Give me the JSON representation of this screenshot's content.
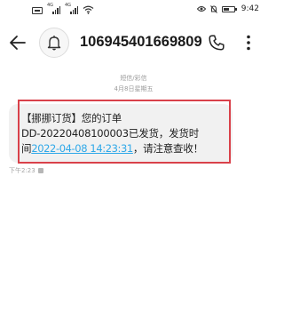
{
  "status_bar": {
    "time": "9:42",
    "signal_tag_1": "4G",
    "signal_tag_2": "4G"
  },
  "header": {
    "contact_number": "106945401669809"
  },
  "conversation": {
    "message_type": "短信/彩信",
    "date": "4月8日星期五",
    "message": {
      "line1": "【挪挪订货】您的订单",
      "line2": "DD-20220408100003已发货，发货时",
      "line3_prefix": "间",
      "link": "2022-04-08 14:23:31",
      "line3_suffix": "，请注意查收！"
    },
    "sent_time": "下午2:23"
  }
}
